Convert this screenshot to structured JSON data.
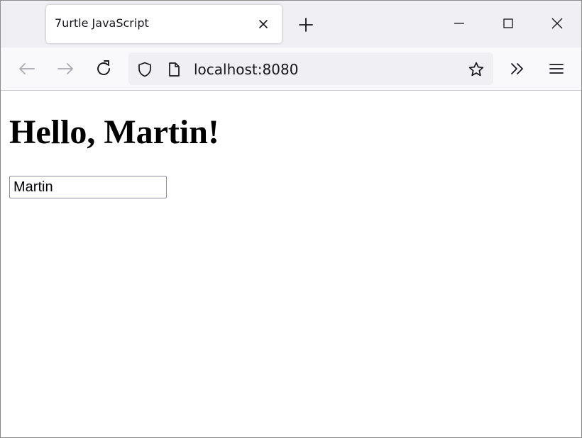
{
  "browser": {
    "tab": {
      "title": "7urtle JavaScript"
    },
    "address_bar": {
      "url": "localhost:8080"
    }
  },
  "icons": {
    "tab_close": "close-icon",
    "new_tab": "plus-icon",
    "minimize": "minimize-icon",
    "maximize": "maximize-icon",
    "close_window": "close-icon",
    "back": "arrow-left-icon",
    "forward": "arrow-right-icon",
    "reload": "reload-icon",
    "tracking_protection": "shield-icon",
    "page_info": "page-icon",
    "bookmark": "star-icon",
    "overflow": "double-chevron-right-icon",
    "menu": "hamburger-menu-icon"
  },
  "page": {
    "heading": "Hello, Martin!",
    "name_input": {
      "value": "Martin"
    }
  }
}
